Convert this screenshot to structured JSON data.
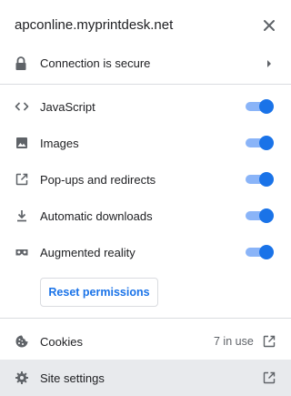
{
  "header": {
    "site": "apconline.myprintdesk.net",
    "close_icon": "close-icon"
  },
  "connection": {
    "label": "Connection is secure",
    "icon": "lock-icon"
  },
  "permissions": [
    {
      "label": "JavaScript",
      "icon": "code-icon",
      "enabled": true
    },
    {
      "label": "Images",
      "icon": "image-icon",
      "enabled": true
    },
    {
      "label": "Pop-ups and redirects",
      "icon": "popup-icon",
      "enabled": true
    },
    {
      "label": "Automatic downloads",
      "icon": "download-icon",
      "enabled": true
    },
    {
      "label": "Augmented reality",
      "icon": "ar-headset-icon",
      "enabled": true
    }
  ],
  "reset_button": "Reset permissions",
  "cookies": {
    "label": "Cookies",
    "count": "7 in use",
    "icon": "cookie-icon"
  },
  "site_settings": {
    "label": "Site settings",
    "icon": "gear-icon"
  },
  "colors": {
    "accent": "#1a73e8",
    "toggle_track": "#8ab4f8",
    "text": "#202124",
    "secondary_text": "#5f6368",
    "divider": "#dadce0",
    "hover_bg": "#e8eaed"
  }
}
